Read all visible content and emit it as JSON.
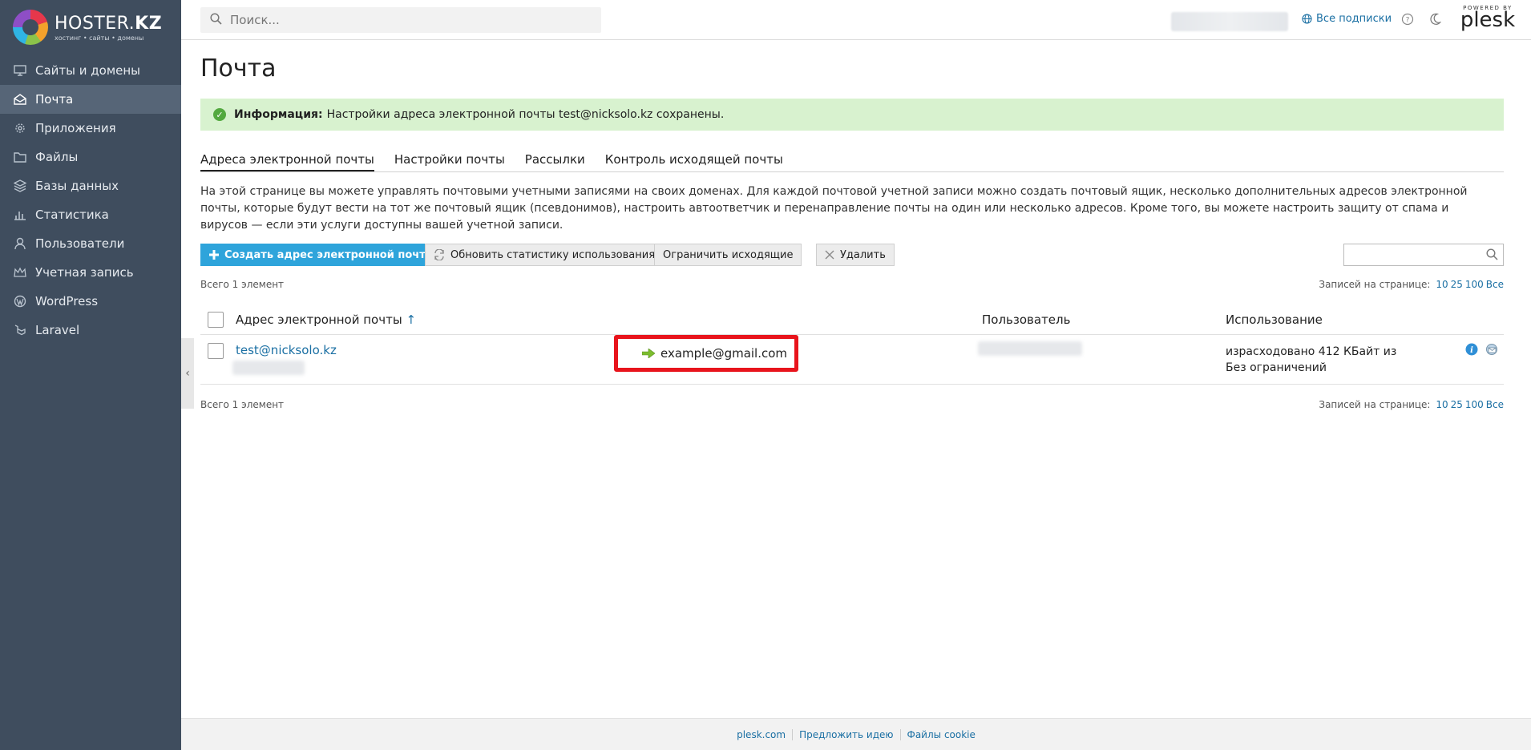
{
  "brand": {
    "name_light": "HOSTER.",
    "name_bold": "KZ",
    "tagline": "хостинг • сайты • домены"
  },
  "sidebar": {
    "items": [
      {
        "label": "Сайты и домены",
        "icon": "monitor-icon"
      },
      {
        "label": "Почта",
        "icon": "mail-icon",
        "active": true
      },
      {
        "label": "Приложения",
        "icon": "gear-icon"
      },
      {
        "label": "Файлы",
        "icon": "folder-icon"
      },
      {
        "label": "Базы данных",
        "icon": "database-icon"
      },
      {
        "label": "Статистика",
        "icon": "bar-chart-icon"
      },
      {
        "label": "Пользователи",
        "icon": "user-icon"
      },
      {
        "label": "Учетная запись",
        "icon": "crown-icon"
      },
      {
        "label": "WordPress",
        "icon": "wordpress-icon"
      },
      {
        "label": "Laravel",
        "icon": "laravel-icon"
      }
    ]
  },
  "topbar": {
    "search_placeholder": "Поиск...",
    "all_subscriptions": "Все подписки",
    "powered_by": "POWERED BY",
    "plesk": "plesk"
  },
  "page": {
    "title": "Почта",
    "message_label": "Информация:",
    "message_text": "Настройки адреса электронной почты test@nicksolo.kz сохранены.",
    "tabs": [
      "Адреса электронной почты",
      "Настройки почты",
      "Рассылки",
      "Контроль исходящей почты"
    ],
    "description": "На этой странице вы можете управлять почтовыми учетными записями на своих доменах. Для каждой почтовой учетной записи можно создать почтовый ящик, несколько дополнительных адресов электронной почты, которые будут вести на тот же почтовый ящик (псевдонимов), настроить автоответчик и перенаправление почты на один или несколько адресов. Кроме того, вы можете настроить защиту от спама и вирусов — если эти услуги доступны вашей учетной записи."
  },
  "toolbar": {
    "create": "Создать адрес электронной почты",
    "refresh": "Обновить статистику использования",
    "limit": "Ограничить исходящие",
    "delete": "Удалить"
  },
  "list": {
    "total": "Всего 1 элемент",
    "per_page_label": "Записей на странице:",
    "per_page_options": [
      "10",
      "25",
      "100",
      "Все"
    ],
    "columns": {
      "address": "Адрес электронной почты",
      "sort_arrow": "↑",
      "user": "Пользователь",
      "usage": "Использование"
    },
    "rows": [
      {
        "address": "test@nicksolo.kz",
        "forward": "example@gmail.com",
        "usage_line1": "израсходовано 412 КБайт из",
        "usage_line2": "Без ограничений"
      }
    ]
  },
  "footer": {
    "links": [
      "plesk.com",
      "Предложить идею",
      "Файлы cookie"
    ]
  }
}
